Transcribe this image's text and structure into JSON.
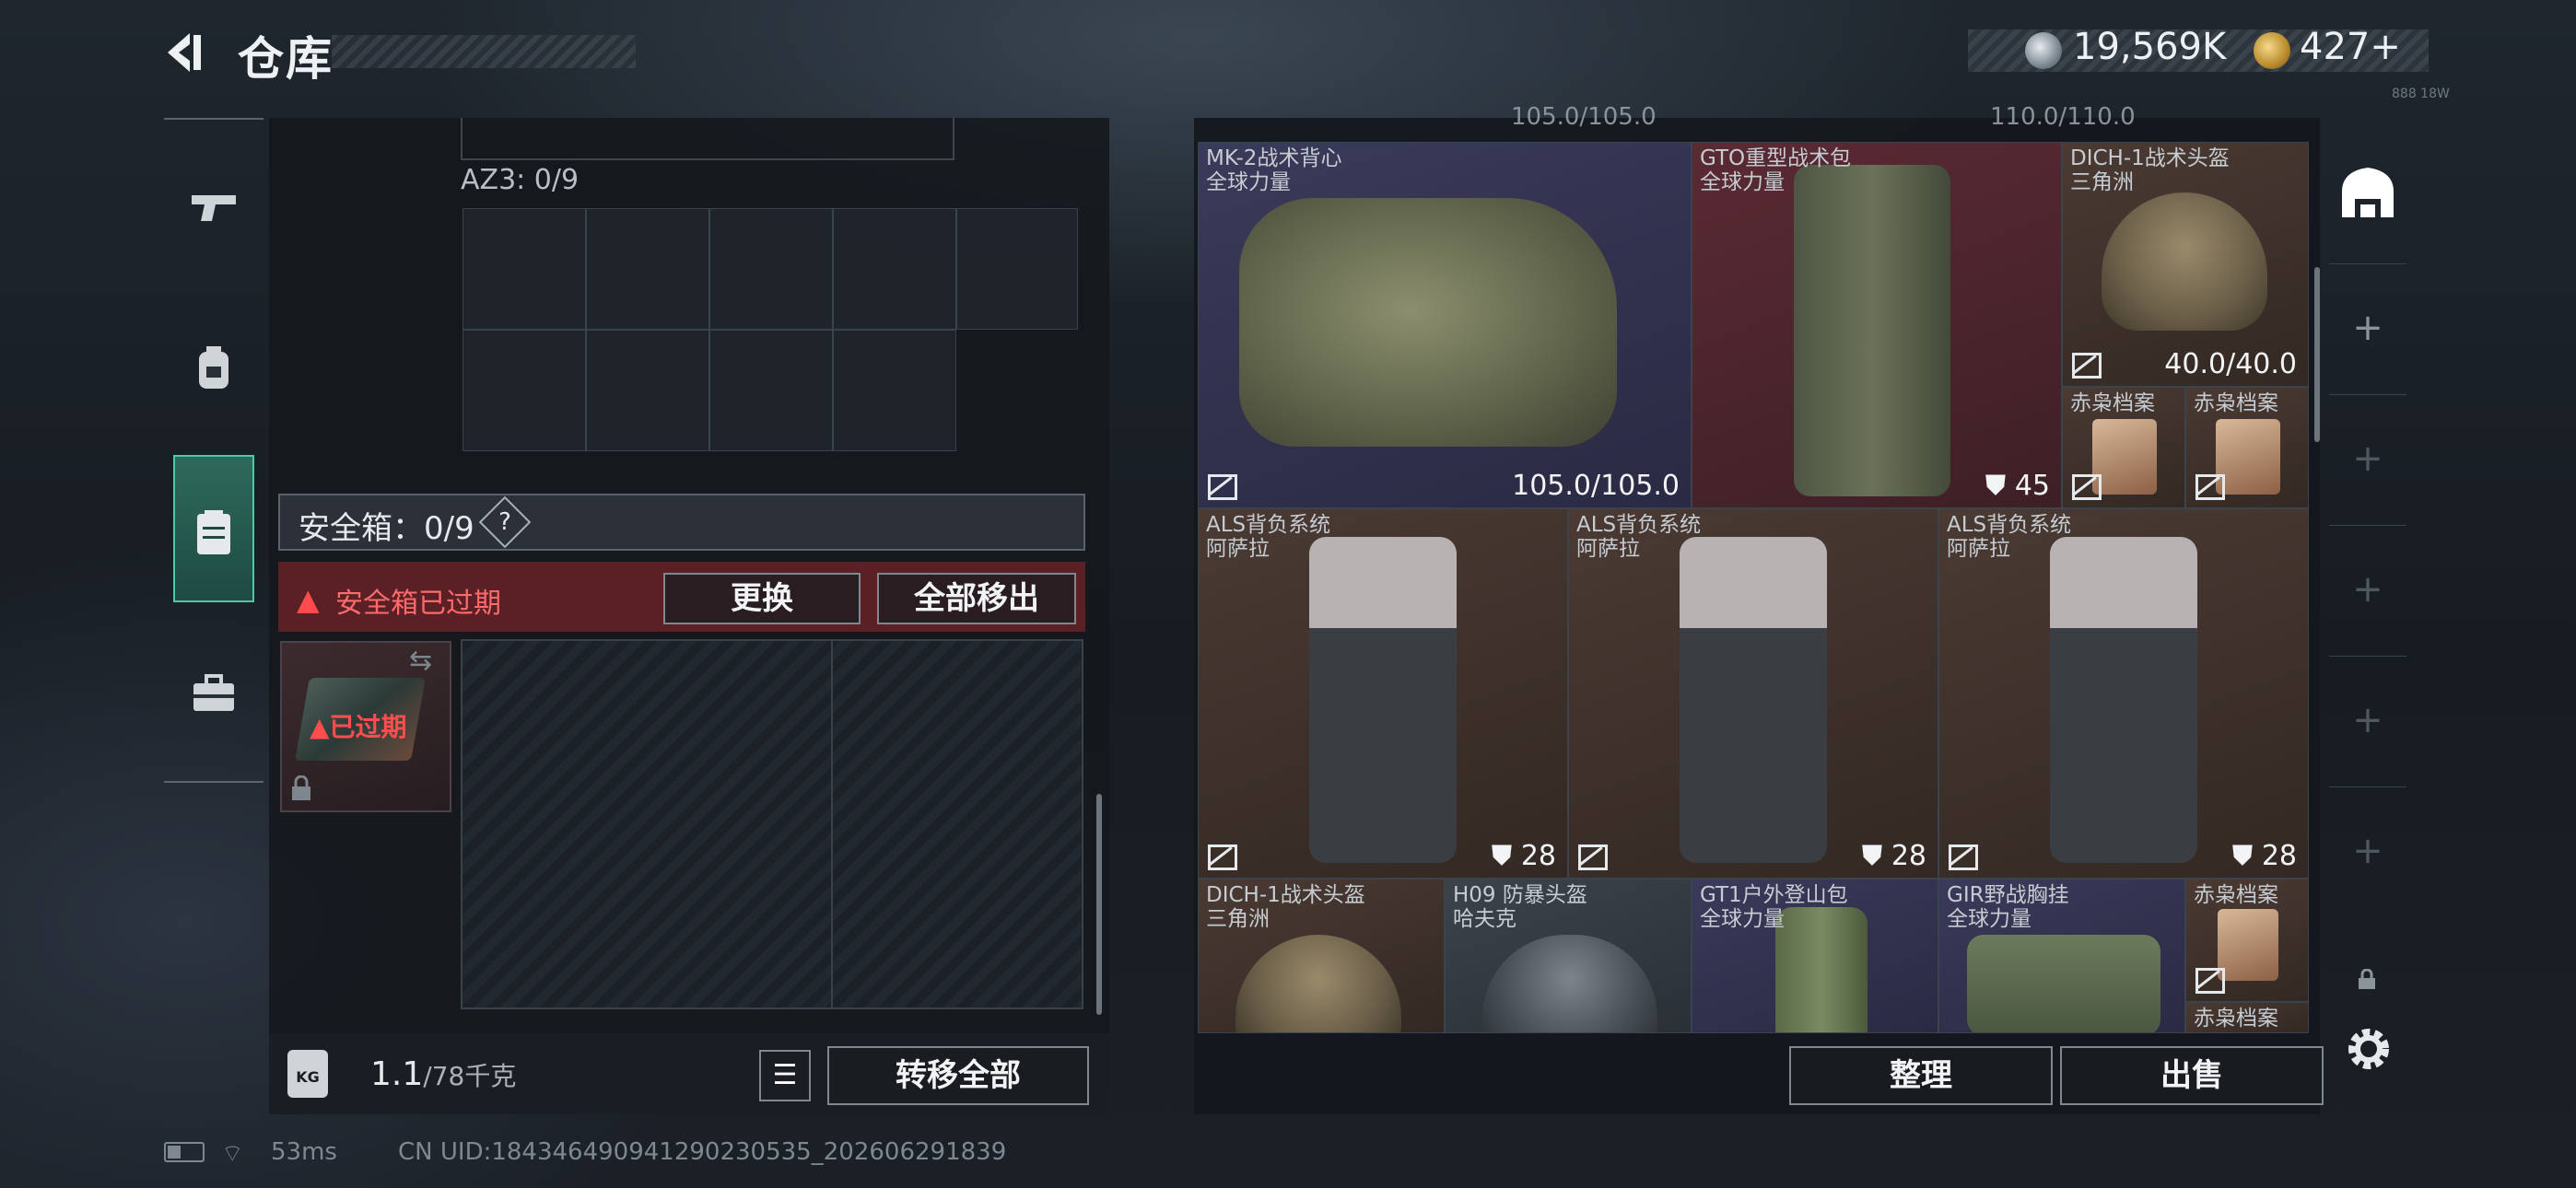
{
  "header": {
    "title": "仓库",
    "currency_silver": "19,569K",
    "currency_gold": "427",
    "plus": "+",
    "tiny_label": "888 18W"
  },
  "left_rail": {
    "items": [
      {
        "icon": "pistol-icon"
      },
      {
        "icon": "backpack-icon"
      },
      {
        "icon": "clipboard-icon"
      },
      {
        "icon": "toolbox-icon"
      }
    ]
  },
  "container": {
    "az3_label": "AZ3: 0/9",
    "safe_label": "安全箱：0/9",
    "safe_help": "?",
    "warning_text": "安全箱已过期",
    "replace_button": "更换",
    "move_all_out_button": "全部移出",
    "case_status": "已过期"
  },
  "bottom_left": {
    "weight_value": "1.1",
    "weight_cap": "/78千克",
    "kg_label": "KG",
    "transfer_all_button": "转移全部"
  },
  "grid_top_cut": [
    "105.0/105.0",
    "110.0/110.0"
  ],
  "items": [
    {
      "name": "MK-2战术背心",
      "sub": "全球力量",
      "value": "105.0/105.0",
      "color": "#2f2f4d"
    },
    {
      "name": "GTO重型战术包",
      "sub": "全球力量",
      "value": "45",
      "color": "#4a232b"
    },
    {
      "name": "DICH-1战术头盔",
      "sub": "三角洲",
      "value": "40.0/40.0",
      "color": "#3b2f2a"
    },
    {
      "name": "赤枭档案",
      "sub": "",
      "value": "",
      "color": "#3b2f2a"
    },
    {
      "name": "赤枭档案",
      "sub": "",
      "value": "",
      "color": "#3b2f2a"
    },
    {
      "name": "ALS背负系统",
      "sub": "阿萨拉",
      "value": "28",
      "color": "#3b2f2a"
    },
    {
      "name": "ALS背负系统",
      "sub": "阿萨拉",
      "value": "28",
      "color": "#3b2f2a"
    },
    {
      "name": "ALS背负系统",
      "sub": "阿萨拉",
      "value": "28",
      "color": "#3b2f2a"
    },
    {
      "name": "DICH-1战术头盔",
      "sub": "三角洲",
      "value": "",
      "color": "#3b2f2a"
    },
    {
      "name": "H09 防暴头盔",
      "sub": "哈夫克",
      "value": "",
      "color": "#3a3f46"
    },
    {
      "name": "GT1户外登山包",
      "sub": "全球力量",
      "value": "",
      "color": "#2f2f4d"
    },
    {
      "name": "GIR野战胸挂",
      "sub": "全球力量",
      "value": "",
      "color": "#2f2f4d"
    },
    {
      "name": "赤枭档案",
      "sub": "",
      "value": "",
      "color": "#3b2f2a"
    },
    {
      "name": "赤枭档案",
      "sub": "",
      "value": "",
      "color": "#3b2f2a"
    }
  ],
  "bottom_right": {
    "sort_button": "整理",
    "sell_button": "出售"
  },
  "right_rail": {
    "plus": "+",
    "icons": [
      "storage-icon",
      "settings-icon",
      "lock-small-icon"
    ]
  },
  "status_bar": {
    "ping": "53ms",
    "uid": "CN UID:18434649094129023053​5_202606291839"
  }
}
